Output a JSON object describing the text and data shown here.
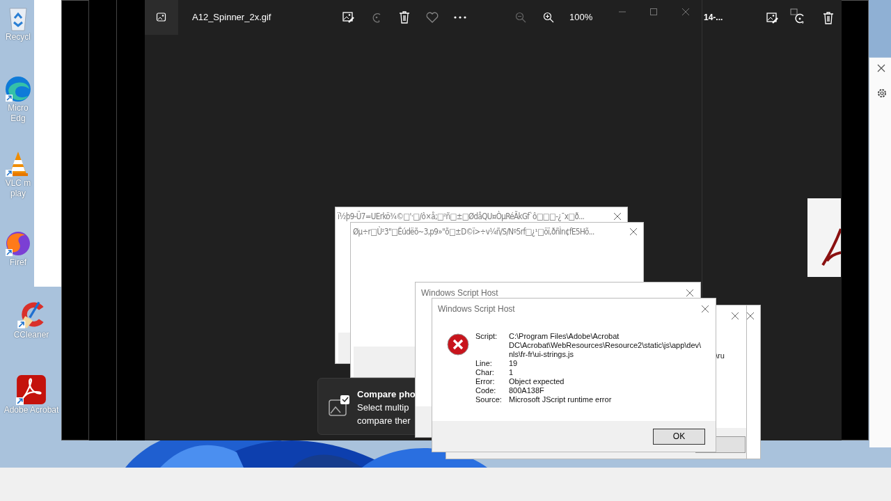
{
  "desktop": {
    "icons": [
      {
        "label": "Recycl"
      },
      {
        "label": "Micro Edg"
      },
      {
        "label": "VLC m play"
      },
      {
        "label": "Firef"
      },
      {
        "label": "CCleaner"
      },
      {
        "label": "Adobe Acrobat"
      }
    ]
  },
  "photo_viewer": {
    "file_name": "A12_Spinner_2x.gif",
    "zoom": "100%"
  },
  "background_viewer": {
    "file_name": "14-..."
  },
  "garbled_dialogs": [
    {
      "title": "ï½þ9-Ü7=UErkö¾©□'·□/ô×å;□²ñ□±□ØdåQU¤ÒµRéÃkGf`ô□□□-¿¯x□ð..."
    },
    {
      "title": "Øµ÷r□Ù²3\"□Ëúdëõ~3,p9»\"õ□±D©ï>÷v¼ñ/S/Nº5rf□¿¹□öï,ðñÌn¢fE5Hõ..."
    }
  ],
  "script_host_back": {
    "title": "Windows Script Host"
  },
  "back_dialog_fragment": {
    "text": "\\ru"
  },
  "error_dialog": {
    "title": "Windows Script Host",
    "fields": [
      {
        "label": "Script:",
        "value": "C:\\Program Files\\Adobe\\Acrobat DC\\Acrobat\\WebResources\\Resource2\\static\\js\\app\\dev\\nls\\fr-fr\\ui-strings.js"
      },
      {
        "label": "Line:",
        "value": "19"
      },
      {
        "label": "Char:",
        "value": "1"
      },
      {
        "label": "Error:",
        "value": "Object expected"
      },
      {
        "label": "Code:",
        "value": "800A138F"
      },
      {
        "label": "Source:",
        "value": "Microsoft JScript runtime error"
      }
    ],
    "button": "OK"
  },
  "toast": {
    "title": "Compare pho",
    "lines": [
      "Select multip",
      "compare ther"
    ]
  }
}
